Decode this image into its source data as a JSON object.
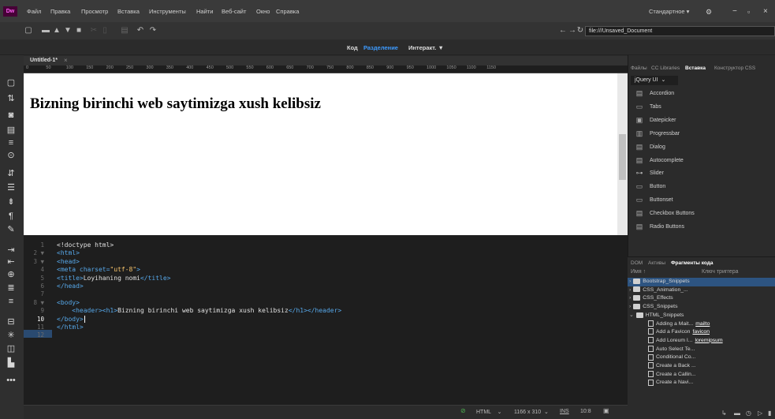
{
  "app": {
    "logo": "Dw",
    "workspace": "Стандартное",
    "workspace_chevron": "▾"
  },
  "menu": [
    "Файл",
    "Правка",
    "Просмотр",
    "Вставка",
    "Инструменты",
    "Найти",
    "Веб-сайт",
    "Окно",
    "Справка"
  ],
  "url": "file:///Unsaved_Document",
  "viewmodes": {
    "code": "Код",
    "split": "Разделение",
    "live": "Интеракт."
  },
  "doc": {
    "tab": "Untitled-1*",
    "close": "×"
  },
  "ruler": [
    "0",
    "50",
    "100",
    "150",
    "200",
    "250",
    "300",
    "350",
    "400",
    "450",
    "500",
    "550",
    "600",
    "650",
    "700",
    "750",
    "800",
    "850",
    "900",
    "950",
    "1000",
    "1050",
    "1100",
    "1150"
  ],
  "design": {
    "h1": "Bizning birinchi web saytimizga xush kelibsiz"
  },
  "code_lines": [
    {
      "n": "1",
      "parts": [
        {
          "t": "<!doctype html>",
          "c": "txt"
        }
      ]
    },
    {
      "n": "2 ▼",
      "parts": [
        {
          "t": "<html>",
          "c": "tag"
        }
      ]
    },
    {
      "n": "3 ▼",
      "parts": [
        {
          "t": "<head>",
          "c": "tag"
        }
      ]
    },
    {
      "n": "4",
      "parts": [
        {
          "t": "<meta charset=",
          "c": "tag"
        },
        {
          "t": "\"utf-8\"",
          "c": "str"
        },
        {
          "t": ">",
          "c": "tag"
        }
      ]
    },
    {
      "n": "5",
      "parts": [
        {
          "t": "<title>",
          "c": "tag"
        },
        {
          "t": "Loyihaning nomi",
          "c": "txt"
        },
        {
          "t": "</title>",
          "c": "tag"
        }
      ]
    },
    {
      "n": "6",
      "parts": [
        {
          "t": "</head>",
          "c": "tag"
        }
      ]
    },
    {
      "n": "7",
      "parts": []
    },
    {
      "n": "8 ▼",
      "parts": [
        {
          "t": "<body>",
          "c": "tag"
        }
      ]
    },
    {
      "n": "9",
      "parts": [
        {
          "t": "    <header><h1>",
          "c": "tag"
        },
        {
          "t": "Bizning birinchi web saytimizga xush kelibsiz",
          "c": "txt"
        },
        {
          "t": "</h1></header>",
          "c": "tag"
        }
      ]
    },
    {
      "n": "10",
      "parts": [
        {
          "t": "</body>",
          "c": "tag"
        }
      ]
    },
    {
      "n": "11",
      "parts": [
        {
          "t": "</html>",
          "c": "tag"
        }
      ]
    },
    {
      "n": "12",
      "parts": []
    }
  ],
  "status": {
    "lang": "HTML",
    "size": "1166 x 310",
    "mode": "INS",
    "pos": "10:8"
  },
  "panel_tabs": [
    "Файлы",
    "CC Libraries",
    "Вставка",
    "Конструктор CSS"
  ],
  "insert": {
    "category": "jQuery UI",
    "items": [
      "Accordion",
      "Tabs",
      "Datepicker",
      "Progressbar",
      "Dialog",
      "Autocomplete",
      "Slider",
      "Button",
      "Buttonset",
      "Checkbox Buttons",
      "Radio Buttons"
    ]
  },
  "snippet_tabs": [
    "DOM",
    "Активы",
    "Фрагменты кода"
  ],
  "snippet_cols": {
    "name": "Имя ↑",
    "trigger": "Ключ триггера"
  },
  "folders": [
    "Bootstrap_Snippets",
    "CSS_Animation_...",
    "CSS_Effects",
    "CSS_Snippets",
    "HTML_Snippets"
  ],
  "snippets": [
    {
      "name": "Adding a Mait...",
      "trigger": "mailto"
    },
    {
      "name": "Add a Favicon",
      "trigger": "favicon"
    },
    {
      "name": "Add Loreum I...",
      "trigger": "loremipsum"
    },
    {
      "name": "Auto Select Te...",
      "trigger": ""
    },
    {
      "name": "Conditional Co...",
      "trigger": ""
    },
    {
      "name": "Create a Back ...",
      "trigger": ""
    },
    {
      "name": "Create a Callin...",
      "trigger": ""
    },
    {
      "name": "Create a Navi...",
      "trigger": ""
    }
  ]
}
